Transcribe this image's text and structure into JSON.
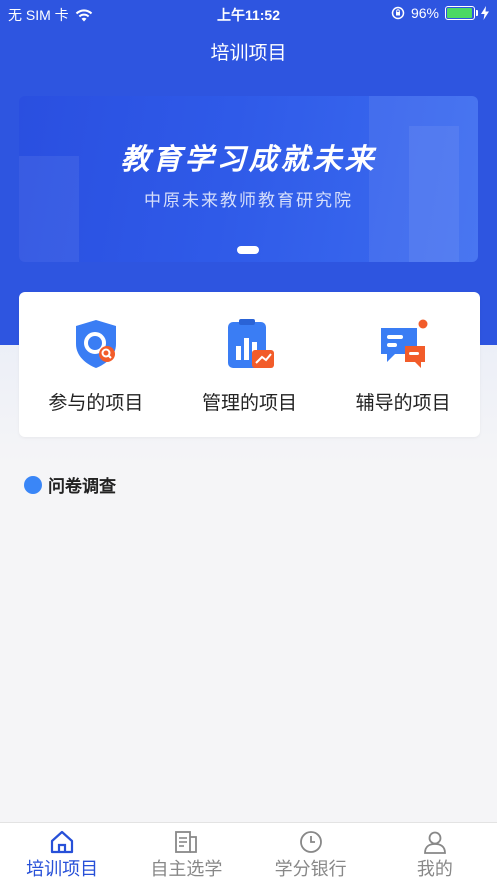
{
  "status_bar": {
    "carrier": "无 SIM 卡",
    "time": "上午11:52",
    "battery": "96%"
  },
  "nav": {
    "title": "培训项目"
  },
  "banner": {
    "title": "教育学习成就未来",
    "subtitle": "中原未来教师教育研究院"
  },
  "menu": {
    "items": [
      {
        "label": "参与的项目",
        "icon": "shield-search-icon"
      },
      {
        "label": "管理的项目",
        "icon": "clipboard-chart-icon"
      },
      {
        "label": "辅导的项目",
        "icon": "chat-bubble-icon"
      }
    ]
  },
  "section": {
    "title": "问卷调查"
  },
  "tabbar": {
    "items": [
      {
        "label": "培训项目",
        "icon": "home-icon",
        "active": true
      },
      {
        "label": "自主选学",
        "icon": "document-icon",
        "active": false
      },
      {
        "label": "学分银行",
        "icon": "clock-icon",
        "active": false
      },
      {
        "label": "我的",
        "icon": "user-icon",
        "active": false
      }
    ]
  },
  "colors": {
    "primary": "#2e55e0",
    "active_tab": "#2750d8",
    "section_dot": "#3a86f7",
    "accent_orange": "#f25c2a"
  }
}
